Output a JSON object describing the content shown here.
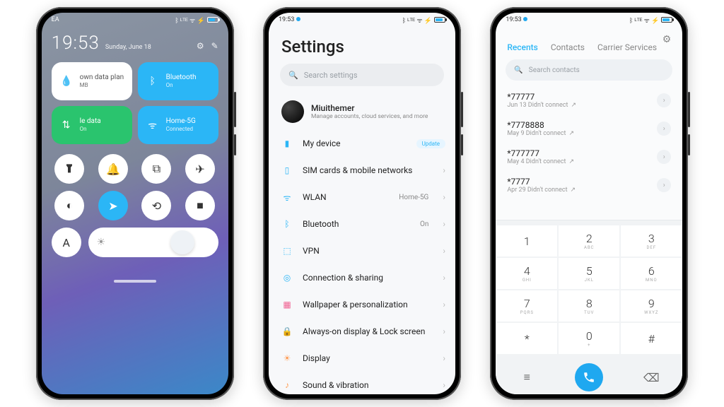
{
  "statusbar": {
    "time": "19:53",
    "ea": "EA",
    "indicators": "ᛒ ᴸᵀᴱ ᯤ ⚡"
  },
  "phone1": {
    "time": "19:53",
    "date": "Sunday, June 18",
    "tiles": {
      "data_plan": {
        "title": "own data plan",
        "sub": "MB"
      },
      "bluetooth": {
        "title": "Bluetooth",
        "sub": "On"
      },
      "mobile_data": {
        "title": "le data",
        "sub": "On"
      },
      "wifi": {
        "title": "Home-5G",
        "sub": "Connected"
      }
    }
  },
  "phone2": {
    "title": "Settings",
    "search_placeholder": "Search settings",
    "account": {
      "name": "Miuithemer",
      "desc": "Manage accounts, cloud services, and more"
    },
    "update_badge": "Update",
    "items": [
      {
        "label": "My device",
        "value": "",
        "badge": true
      },
      {
        "label": "SIM cards & mobile networks",
        "value": ""
      },
      {
        "label": "WLAN",
        "value": "Home-5G"
      },
      {
        "label": "Bluetooth",
        "value": "On"
      },
      {
        "label": "VPN",
        "value": ""
      },
      {
        "label": "Connection & sharing",
        "value": ""
      },
      {
        "label": "Wallpaper & personalization",
        "value": ""
      },
      {
        "label": "Always-on display & Lock screen",
        "value": ""
      },
      {
        "label": "Display",
        "value": ""
      },
      {
        "label": "Sound & vibration",
        "value": ""
      }
    ]
  },
  "phone3": {
    "tabs": {
      "recents": "Recents",
      "contacts": "Contacts",
      "carrier": "Carrier Services"
    },
    "search_placeholder": "Search contacts",
    "calls": [
      {
        "number": "*77777",
        "meta": "Jun 13 Didn't connect"
      },
      {
        "number": "*7778888",
        "meta": "May 9 Didn't connect"
      },
      {
        "number": "*777777",
        "meta": "May 4 Didn't connect"
      },
      {
        "number": "*7777",
        "meta": "Apr 29 Didn't connect"
      }
    ],
    "keys": [
      {
        "n": "1",
        "l": ""
      },
      {
        "n": "2",
        "l": "ABC"
      },
      {
        "n": "3",
        "l": "DEF"
      },
      {
        "n": "4",
        "l": "GHI"
      },
      {
        "n": "5",
        "l": "JKL"
      },
      {
        "n": "6",
        "l": "MNO"
      },
      {
        "n": "7",
        "l": "PQRS"
      },
      {
        "n": "8",
        "l": "TUV"
      },
      {
        "n": "9",
        "l": "WXYZ"
      },
      {
        "n": "*",
        "l": ""
      },
      {
        "n": "0",
        "l": "+"
      },
      {
        "n": "#",
        "l": ""
      }
    ]
  }
}
